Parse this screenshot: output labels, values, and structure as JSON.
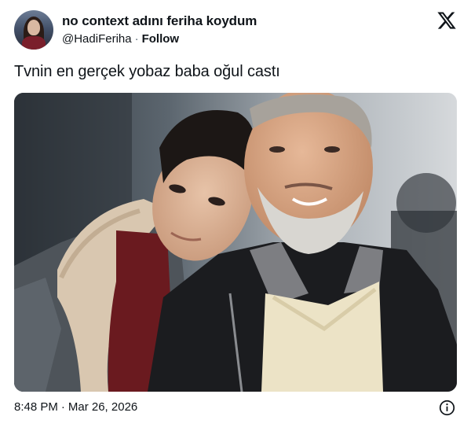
{
  "author": {
    "display_name": "no context adını feriha koydum",
    "handle": "@HadiFeriha",
    "separator": "·",
    "follow_label": "Follow"
  },
  "tweet": {
    "text": "Tvnin en gerçek yobaz baba oğul castı"
  },
  "footer": {
    "time": "8:48 PM",
    "separator": "·",
    "date": "Mar 26, 2026"
  },
  "icons": {
    "brand": "x-logo-icon",
    "info": "info-icon"
  },
  "colors": {
    "text": "#0f1419",
    "secondary": "#536471",
    "background": "#ffffff"
  }
}
